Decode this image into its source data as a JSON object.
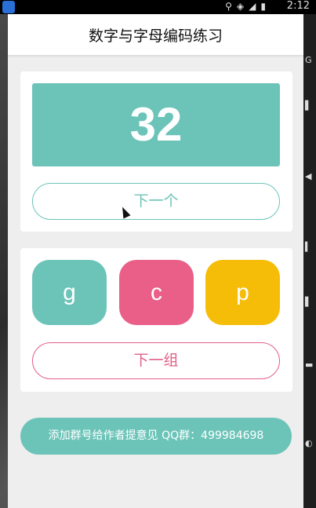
{
  "status_bar": {
    "time": "2:12",
    "icons": [
      "location-icon",
      "wifi-icon",
      "signal-icon",
      "battery-icon"
    ]
  },
  "app": {
    "title": "数字与字母编码练习"
  },
  "number_card": {
    "number": "32",
    "next_button_label": "下一个"
  },
  "letter_card": {
    "letters": [
      "g",
      "c",
      "p"
    ],
    "letter_colors": [
      "#6cc4b9",
      "#e95f88",
      "#f6bd08"
    ],
    "next_group_label": "下一组"
  },
  "footer": {
    "label": "添加群号给作者提意见 QQ群：499984698"
  },
  "colors": {
    "teal": "#6cc4b9",
    "pink": "#e35f88",
    "yellow": "#f6bd08"
  }
}
